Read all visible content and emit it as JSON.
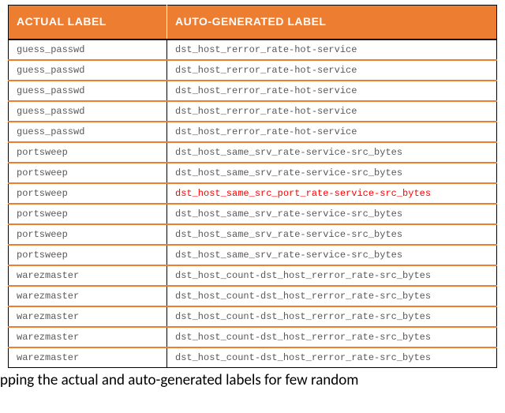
{
  "table": {
    "headers": {
      "actual": "ACTUAL LABEL",
      "auto": "AUTO-GENERATED LABEL"
    },
    "rows": [
      {
        "actual": "guess_passwd",
        "auto": "dst_host_rerror_rate-hot-service",
        "highlight": false
      },
      {
        "actual": "guess_passwd",
        "auto": "dst_host_rerror_rate-hot-service",
        "highlight": false
      },
      {
        "actual": "guess_passwd",
        "auto": "dst_host_rerror_rate-hot-service",
        "highlight": false
      },
      {
        "actual": "guess_passwd",
        "auto": "dst_host_rerror_rate-hot-service",
        "highlight": false
      },
      {
        "actual": "guess_passwd",
        "auto": "dst_host_rerror_rate-hot-service",
        "highlight": false
      },
      {
        "actual": "portsweep",
        "auto": "dst_host_same_srv_rate-service-src_bytes",
        "highlight": false
      },
      {
        "actual": "portsweep",
        "auto": "dst_host_same_srv_rate-service-src_bytes",
        "highlight": false
      },
      {
        "actual": "portsweep",
        "auto": "dst_host_same_src_port_rate-service-src_bytes",
        "highlight": true
      },
      {
        "actual": "portsweep",
        "auto": "dst_host_same_srv_rate-service-src_bytes",
        "highlight": false
      },
      {
        "actual": "portsweep",
        "auto": "dst_host_same_srv_rate-service-src_bytes",
        "highlight": false
      },
      {
        "actual": "portsweep",
        "auto": "dst_host_same_srv_rate-service-src_bytes",
        "highlight": false
      },
      {
        "actual": "warezmaster",
        "auto": "dst_host_count-dst_host_rerror_rate-src_bytes",
        "highlight": false
      },
      {
        "actual": "warezmaster",
        "auto": "dst_host_count-dst_host_rerror_rate-src_bytes",
        "highlight": false
      },
      {
        "actual": "warezmaster",
        "auto": "dst_host_count-dst_host_rerror_rate-src_bytes",
        "highlight": false
      },
      {
        "actual": "warezmaster",
        "auto": "dst_host_count-dst_host_rerror_rate-src_bytes",
        "highlight": false
      },
      {
        "actual": "warezmaster",
        "auto": "dst_host_count-dst_host_rerror_rate-src_bytes",
        "highlight": false
      }
    ]
  },
  "caption": "pping the actual and auto-generated labels for few random"
}
